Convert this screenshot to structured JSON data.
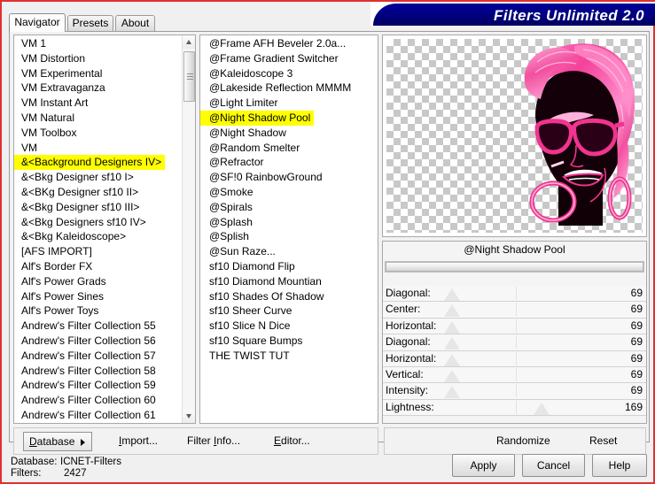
{
  "window": {
    "title": "Filters Unlimited 2.0",
    "accent_blue": "#00007e",
    "frame_red": "#e03030",
    "highlight_yellow": "#ffff00"
  },
  "tabs": [
    {
      "label": "Navigator",
      "active": true
    },
    {
      "label": "Presets",
      "active": false
    },
    {
      "label": "About",
      "active": false
    }
  ],
  "category_list": {
    "name": "filter-category-list",
    "selected": "&<Background Designers IV>",
    "items": [
      "VM 1",
      "VM Distortion",
      "VM Experimental",
      "VM Extravaganza",
      "VM Instant Art",
      "VM Natural",
      "VM Toolbox",
      "VM",
      "&<Background Designers IV>",
      "&<Bkg Designer sf10 I>",
      "&<BKg Designer sf10 II>",
      "&<Bkg Designer sf10 III>",
      "&<Bkg Designers sf10 IV>",
      "&<Bkg Kaleidoscope>",
      "[AFS IMPORT]",
      "Alf's Border FX",
      "Alf's Power Grads",
      "Alf's Power Sines",
      "Alf's Power Toys",
      "Andrew's Filter Collection 55",
      "Andrew's Filter Collection 56",
      "Andrew's Filter Collection 57",
      "Andrew's Filter Collection 58",
      "Andrew's Filter Collection 59",
      "Andrew's Filter Collection 60",
      "Andrew's Filter Collection 61"
    ]
  },
  "effect_list": {
    "name": "filter-effect-list",
    "selected": "@Night Shadow Pool",
    "items": [
      "@Frame AFH Beveler 2.0a...",
      "@Frame Gradient Switcher",
      "@Kaleidoscope 3",
      "@Lakeside Reflection MMMM",
      "@Light Limiter",
      "@Night Shadow Pool",
      "@Night Shadow",
      "@Random Smelter",
      "@Refractor",
      "@SF!0 RainbowGround",
      "@Smoke",
      "@Spirals",
      "@Splash",
      "@Splish",
      "@Sun Raze...",
      "sf10 Diamond Flip",
      "sf10 Diamond Mountian",
      "sf10 Shades Of Shadow",
      "sf10 Sheer Curve",
      "sf10 Slice N Dice",
      "sf10 Square Bumps",
      "THE TWIST TUT"
    ]
  },
  "preview": {
    "name": "filter-preview",
    "alt": "pink-haired woman silhouette with sunglasses on transparent checkerboard"
  },
  "params": {
    "filter_name": "@Night Shadow Pool",
    "sliders": [
      {
        "label": "Diagonal:",
        "value": "69",
        "pos": 28
      },
      {
        "label": "Center:",
        "value": "69",
        "pos": 28
      },
      {
        "label": "Horizontal:",
        "value": "69",
        "pos": 28
      },
      {
        "label": "Diagonal:",
        "value": "69",
        "pos": 28
      },
      {
        "label": "Horizontal:",
        "value": "69",
        "pos": 28
      },
      {
        "label": "Vertical:",
        "value": "69",
        "pos": 28
      },
      {
        "label": "Intensity:",
        "value": "69",
        "pos": 28
      },
      {
        "label": "Lightness:",
        "value": "169",
        "pos": 64
      }
    ]
  },
  "actionbar": {
    "database": "Database",
    "import": "Import...",
    "filter_info": "Filter Info...",
    "editor": "Editor...",
    "randomize": "Randomize",
    "reset": "Reset"
  },
  "status": {
    "database_label": "Database:",
    "database_value": "ICNET-Filters",
    "filters_label": "Filters:",
    "filters_value": "2427"
  },
  "buttons": {
    "apply": "Apply",
    "cancel": "Cancel",
    "help": "Help"
  }
}
